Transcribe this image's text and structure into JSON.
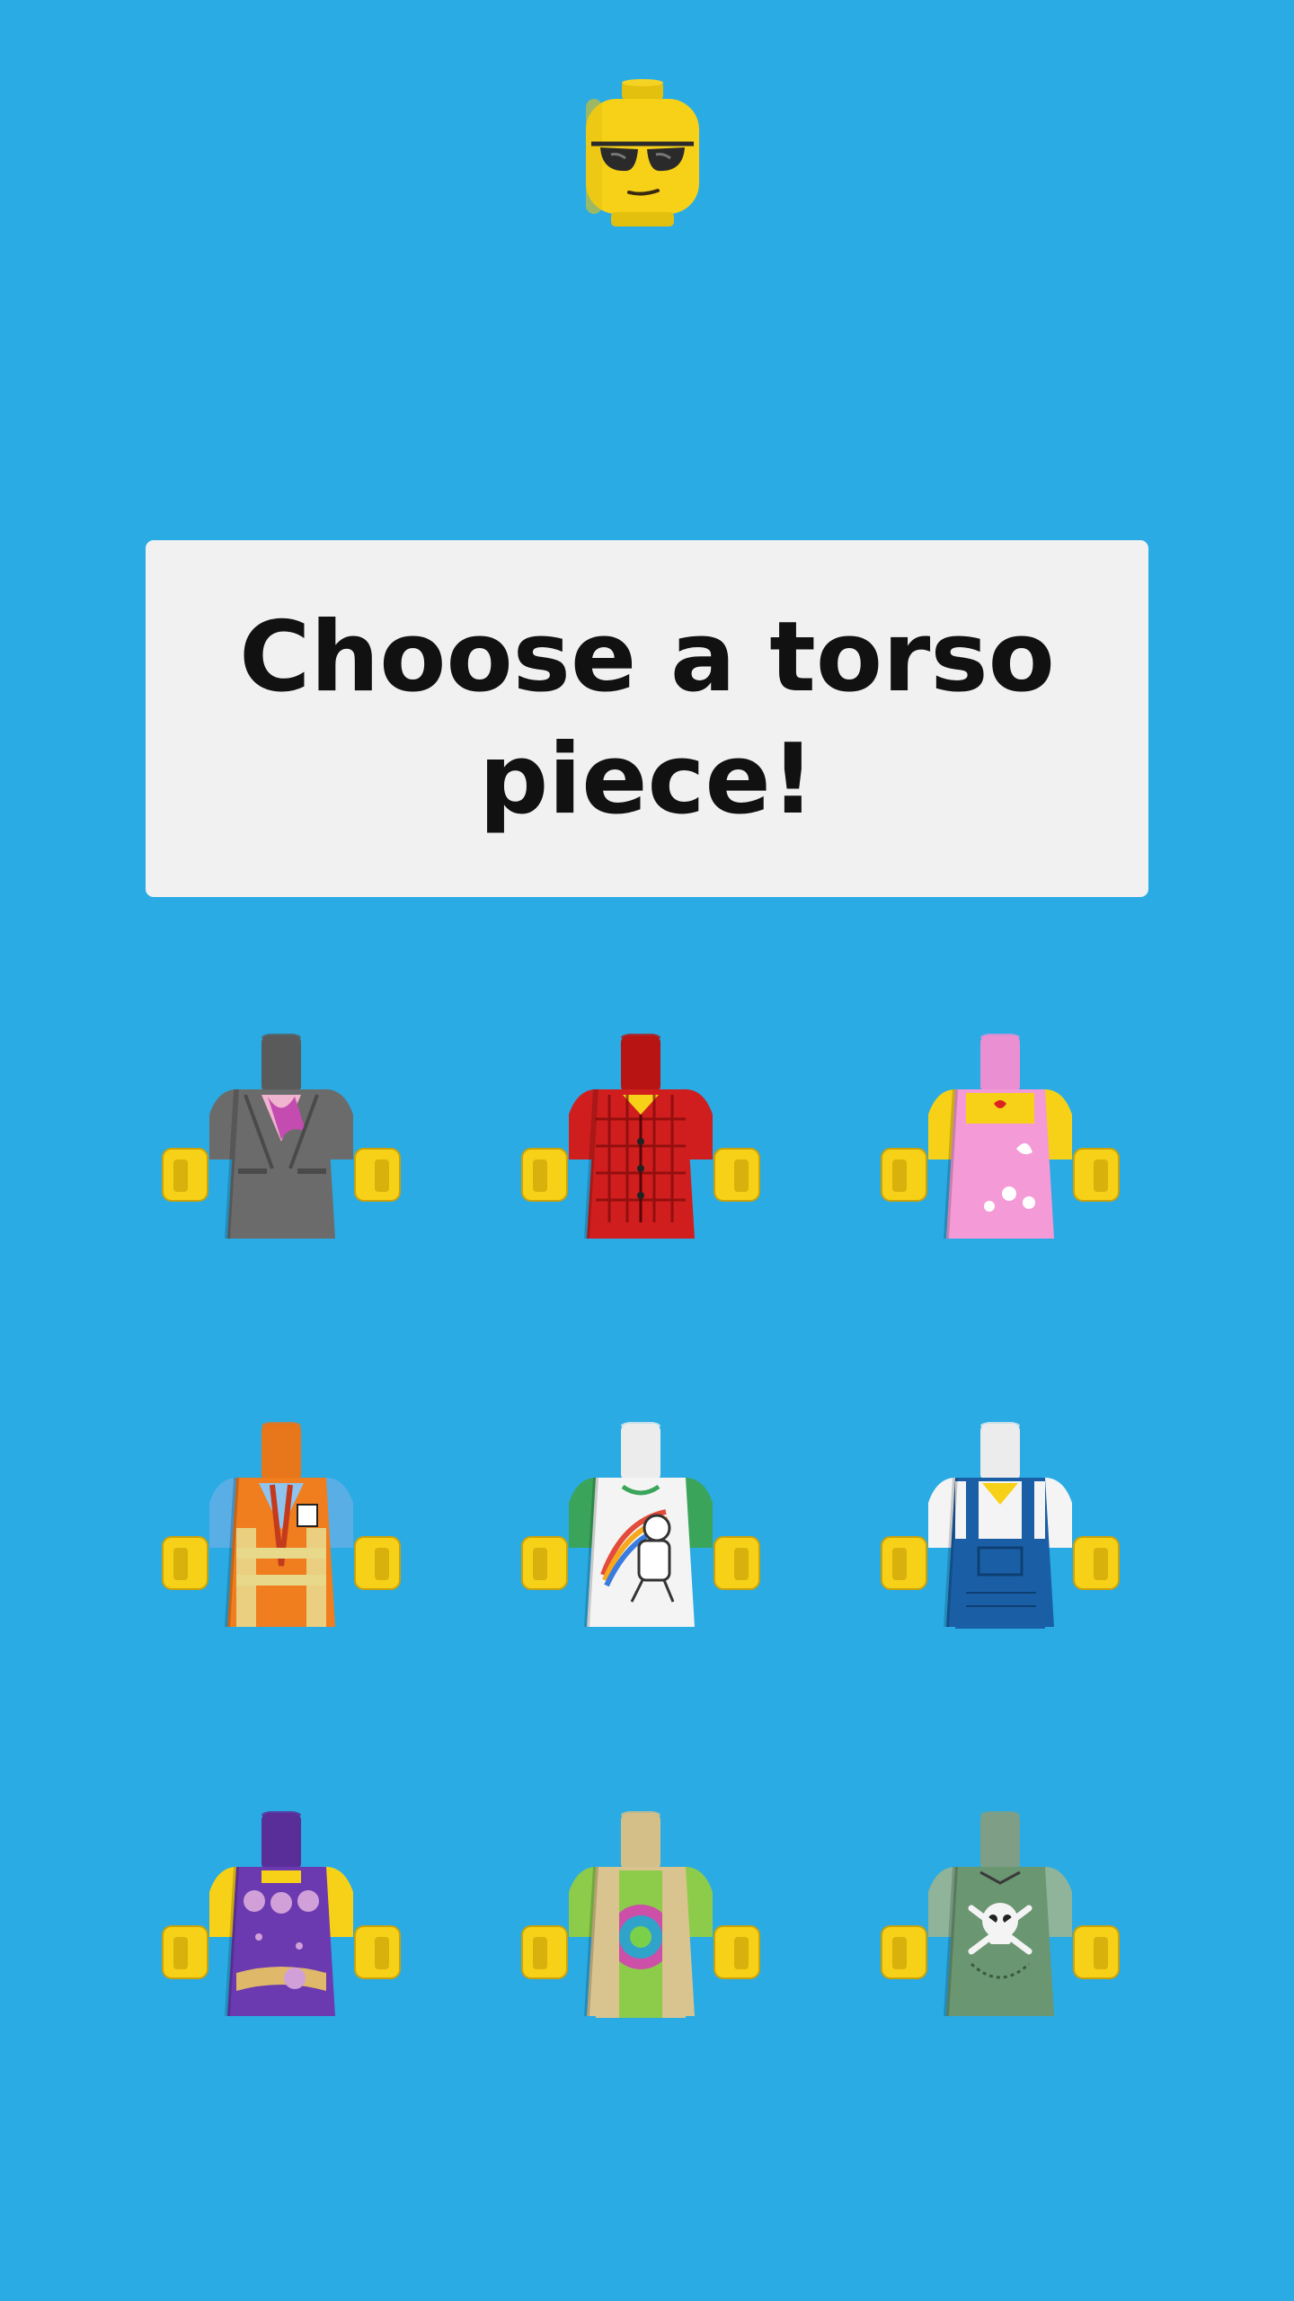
{
  "prompt": {
    "title": "Choose a torso piece!"
  },
  "colors": {
    "background": "#2aabe4",
    "card": "#f2f1f2",
    "text": "#111111",
    "skin": "#f7d117"
  },
  "torsos": [
    {
      "name": "grey-business-suit",
      "icon": "grey-suit-torso-icon",
      "body": "#6b6b6b",
      "arms": "#6b6b6b",
      "neck": "#5a5a5a",
      "accent": "#c44bb0"
    },
    {
      "name": "red-plaid-shirt",
      "icon": "red-plaid-torso-icon",
      "body": "#d01e1e",
      "arms": "#d01e1e",
      "neck": "#b81414",
      "accent": "#7a0a0a"
    },
    {
      "name": "pink-butterfly-dress",
      "icon": "pink-dress-torso-icon",
      "body": "#f49ad6",
      "arms": "#f7d117",
      "neck": "#eb8fd3",
      "accent": "#ffffff"
    },
    {
      "name": "orange-safety-vest",
      "icon": "safety-vest-torso-icon",
      "body": "#f07d1e",
      "arms": "#5aaee6",
      "neck": "#e8761a",
      "accent": "#e8d88a"
    },
    {
      "name": "white-astronaut-tee",
      "icon": "astronaut-tee-torso-icon",
      "body": "#f4f4f4",
      "arms": "#3aa55a",
      "neck": "#ececec",
      "accent": "#e34b3b"
    },
    {
      "name": "blue-overalls",
      "icon": "overalls-torso-icon",
      "body": "#1a5fa6",
      "arms": "#f4f4f4",
      "neck": "#ececec",
      "accent": "#f7d117"
    },
    {
      "name": "purple-floral-top",
      "icon": "floral-top-torso-icon",
      "body": "#6b3ab0",
      "arms": "#f7d117",
      "neck": "#5a2e99",
      "accent": "#d2a0d8"
    },
    {
      "name": "tan-tie-dye-vest",
      "icon": "tie-dye-vest-torso-icon",
      "body": "#d9c48f",
      "arms": "#8ccc4a",
      "neck": "#d4bf88",
      "accent": "#cc4fa8"
    },
    {
      "name": "sand-green-skull",
      "icon": "skull-overalls-torso-icon",
      "body": "#6b9672",
      "arms": "#8fb49a",
      "neck": "#7e9f86",
      "accent": "#f4f4f4"
    }
  ]
}
